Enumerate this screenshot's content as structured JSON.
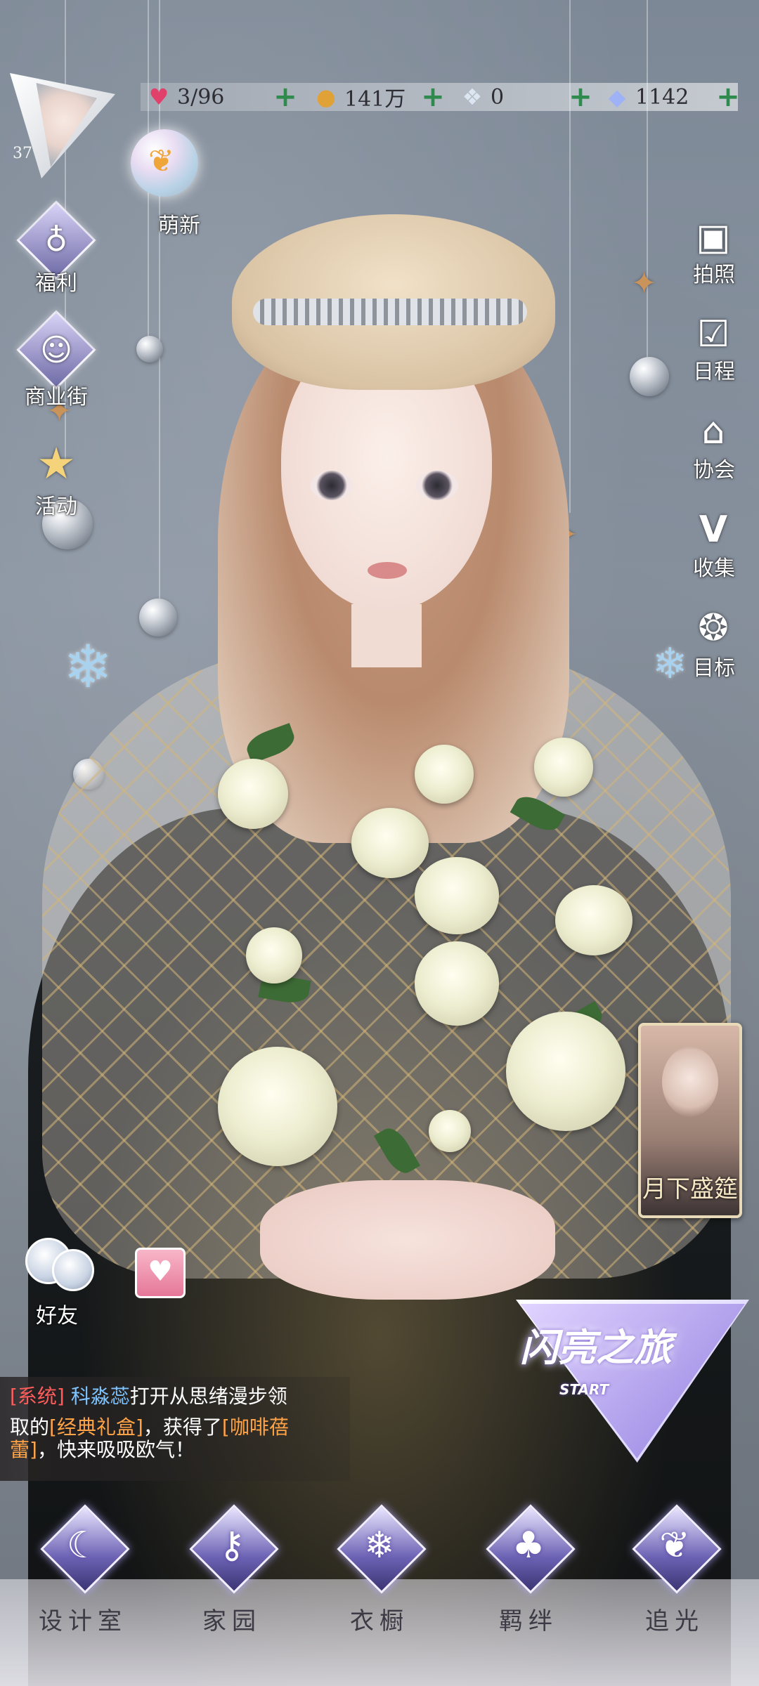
{
  "player": {
    "level": "37"
  },
  "resources": [
    {
      "icon": "heart-gem-icon",
      "value": "3/96",
      "color": "#e0406a"
    },
    {
      "icon": "gold-coin-icon",
      "value": "141万",
      "color": "#e0a236"
    },
    {
      "icon": "crystal-flower-icon",
      "value": "0",
      "color": "#c9d8ea"
    },
    {
      "icon": "diamond-icon",
      "value": "1142",
      "color": "#9fb2f5"
    }
  ],
  "left_menu": {
    "newbie": "萌新",
    "welfare": "福利",
    "shop_street": "商业街",
    "activity": "活动"
  },
  "right_menu": {
    "photo": "拍照",
    "schedule": "日程",
    "guild": "协会",
    "collection": "收集",
    "goal": "目标"
  },
  "event_card": {
    "title": "月下盛筵"
  },
  "friends_label": "好友",
  "chat": {
    "tag": "[系统]",
    "player_name": "科淼蕊",
    "text1": "打开从思绪漫步领",
    "text2": "取的",
    "item1": "[经典礼盒]",
    "text3": "，获得了",
    "item2": "[咖啡蓓",
    "item2_cont": "蕾]",
    "text4": "，快来吸吸欧气！"
  },
  "start_banner": {
    "title": "闪亮之旅",
    "subtitle": "START"
  },
  "bottom_nav": [
    {
      "label": "设计室",
      "icon": "moon-icon"
    },
    {
      "label": "家园",
      "icon": "key-icon"
    },
    {
      "label": "衣橱",
      "icon": "snowflake-icon"
    },
    {
      "label": "羁绊",
      "icon": "clover-icon"
    },
    {
      "label": "追光",
      "icon": "butterfly-icon"
    }
  ]
}
